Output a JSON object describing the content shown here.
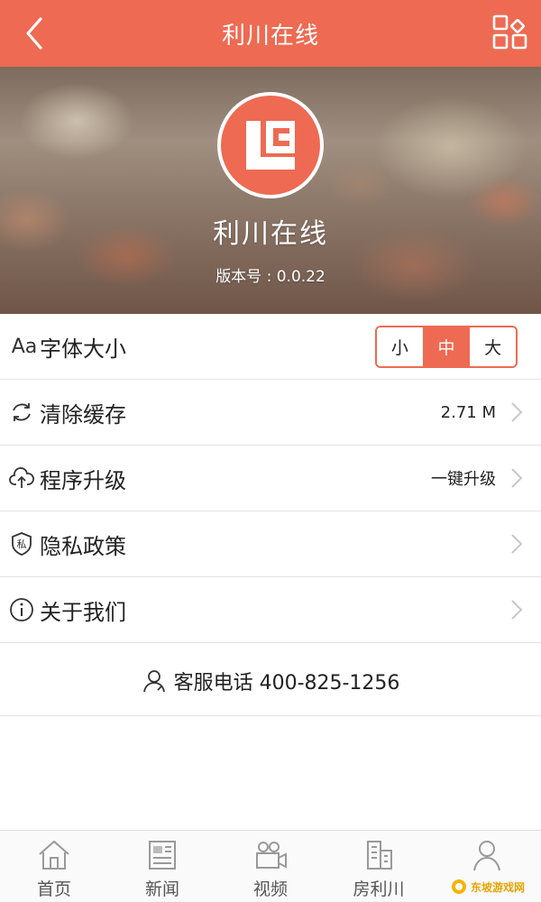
{
  "header": {
    "title": "利川在线",
    "back_icon": "back-icon",
    "grid_icon": "grid-menu-icon"
  },
  "banner": {
    "app_name": "利川在线",
    "version": "版本号 : 0.0.22",
    "logo": "LC"
  },
  "settings": {
    "font_size": {
      "icon_text": "Aa",
      "label": "字体大小",
      "options": [
        "小",
        "中",
        "大"
      ],
      "selected": "中"
    },
    "clear_cache": {
      "label": "清除缓存",
      "value": "2.71 M",
      "icon": "refresh-icon"
    },
    "upgrade": {
      "label": "程序升级",
      "value": "一键升级",
      "icon": "cloud-upload-icon"
    },
    "privacy": {
      "label": "隐私政策",
      "icon": "privacy-shield-icon",
      "icon_text": "私"
    },
    "about": {
      "label": "关于我们",
      "icon": "info-icon"
    }
  },
  "service": {
    "text": "客服电话 400-825-1256",
    "icon": "user-service-icon"
  },
  "tabbar": {
    "items": [
      {
        "label": "首页",
        "icon": "home-icon"
      },
      {
        "label": "新闻",
        "icon": "news-icon"
      },
      {
        "label": "视频",
        "icon": "video-icon"
      },
      {
        "label": "房利川",
        "icon": "building-icon"
      },
      {
        "label": "",
        "icon": "profile-icon"
      }
    ]
  },
  "watermark": {
    "text": "东坡游戏网"
  },
  "colors": {
    "accent": "#ee6a52",
    "divider": "#e3e3e3"
  }
}
